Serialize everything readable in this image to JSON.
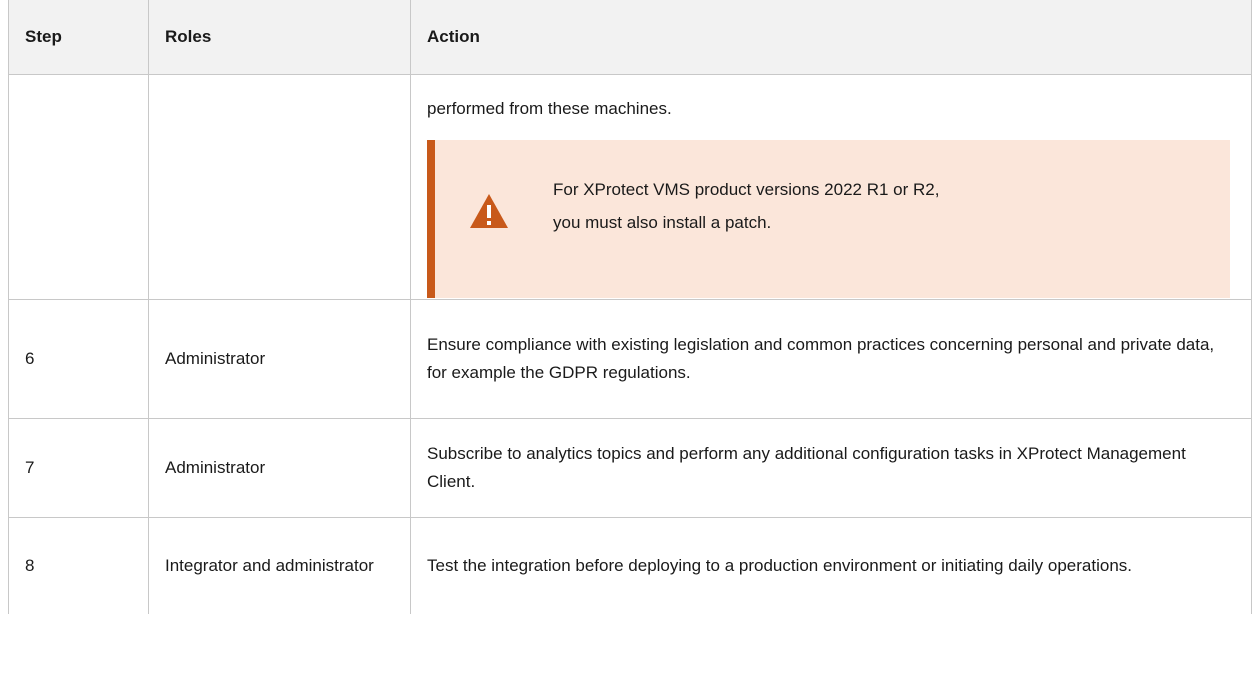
{
  "table": {
    "headers": {
      "step": "Step",
      "roles": "Roles",
      "action": "Action"
    },
    "continuation": {
      "action_text": "performed from these machines.",
      "warning": {
        "line1": "For XProtect VMS product versions 2022 R1 or R2,",
        "line2": "you must also install a patch.",
        "icon": "warning-triangle-icon",
        "accent_color": "#c8591a",
        "background_color": "#fbe6da"
      }
    },
    "rows": [
      {
        "step": "6",
        "roles": "Administrator",
        "action": "Ensure compliance with existing legislation and common practices concerning personal and private data, for example the GDPR regulations."
      },
      {
        "step": "7",
        "roles": "Administrator",
        "action": "Subscribe to analytics topics and perform any additional configuration tasks in XProtect Management Client."
      },
      {
        "step": "8",
        "roles": "Integrator and administrator",
        "action": "Test the integration before deploying to a production environment or initiating daily operations."
      }
    ]
  }
}
